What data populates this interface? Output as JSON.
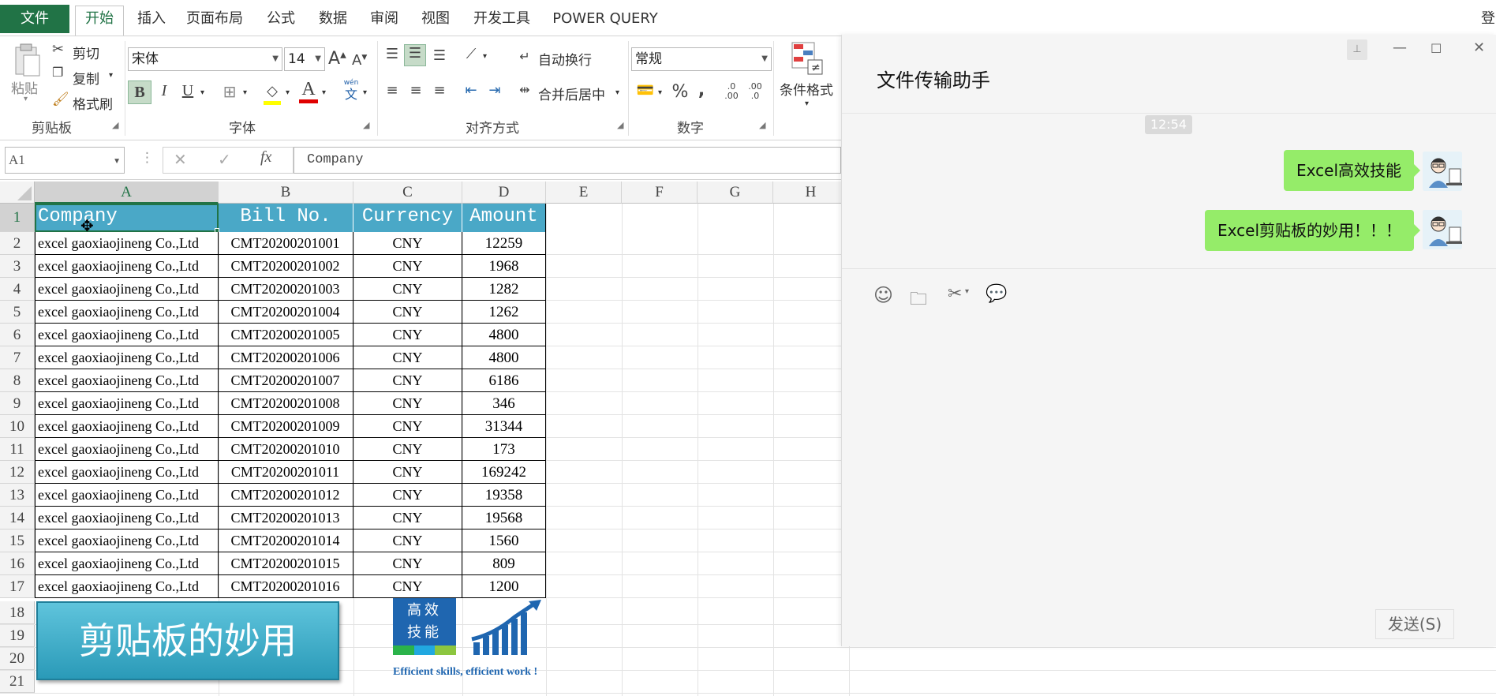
{
  "ribbon": {
    "tabs": [
      "文件",
      "开始",
      "插入",
      "页面布局",
      "公式",
      "数据",
      "审阅",
      "视图",
      "开发工具",
      "POWER QUERY"
    ],
    "user_partial": "登",
    "clipboard": {
      "paste": "粘贴",
      "cut": "剪切",
      "copy": "复制",
      "format_painter": "格式刷",
      "group": "剪贴板"
    },
    "font": {
      "name": "宋体",
      "size": "14",
      "bold": "B",
      "italic": "I",
      "underline": "U",
      "phonetic_top": "wén",
      "phonetic_bottom": "文",
      "group": "字体"
    },
    "alignment": {
      "wrap": "自动换行",
      "merge": "合并后居中",
      "group": "对齐方式"
    },
    "number": {
      "format": "常规",
      "percent": "%",
      "comma": ",",
      "inc_dec": ".0\n.00",
      "dec_dec": ".00\n.0",
      "group": "数字"
    },
    "styles": {
      "conditional": "条件格式"
    }
  },
  "formula_bar": {
    "name_box": "A1",
    "fx": "fx",
    "value": "Company"
  },
  "sheet": {
    "columns": [
      "A",
      "B",
      "C",
      "D",
      "E",
      "F",
      "G",
      "H"
    ],
    "headers": [
      "Company",
      "Bill No.",
      "Currency",
      "Amount"
    ],
    "rows": [
      {
        "n": "2",
        "company": "excel gaoxiaojineng Co.,Ltd",
        "bill": "CMT20200201001",
        "cur": "CNY",
        "amt": "12259"
      },
      {
        "n": "3",
        "company": "excel gaoxiaojineng Co.,Ltd",
        "bill": "CMT20200201002",
        "cur": "CNY",
        "amt": "1968"
      },
      {
        "n": "4",
        "company": "excel gaoxiaojineng Co.,Ltd",
        "bill": "CMT20200201003",
        "cur": "CNY",
        "amt": "1282"
      },
      {
        "n": "5",
        "company": "excel gaoxiaojineng Co.,Ltd",
        "bill": "CMT20200201004",
        "cur": "CNY",
        "amt": "1262"
      },
      {
        "n": "6",
        "company": "excel gaoxiaojineng Co.,Ltd",
        "bill": "CMT20200201005",
        "cur": "CNY",
        "amt": "4800"
      },
      {
        "n": "7",
        "company": "excel gaoxiaojineng Co.,Ltd",
        "bill": "CMT20200201006",
        "cur": "CNY",
        "amt": "4800"
      },
      {
        "n": "8",
        "company": "excel gaoxiaojineng Co.,Ltd",
        "bill": "CMT20200201007",
        "cur": "CNY",
        "amt": "6186"
      },
      {
        "n": "9",
        "company": "excel gaoxiaojineng Co.,Ltd",
        "bill": "CMT20200201008",
        "cur": "CNY",
        "amt": "346"
      },
      {
        "n": "10",
        "company": "excel gaoxiaojineng Co.,Ltd",
        "bill": "CMT20200201009",
        "cur": "CNY",
        "amt": "31344"
      },
      {
        "n": "11",
        "company": "excel gaoxiaojineng Co.,Ltd",
        "bill": "CMT20200201010",
        "cur": "CNY",
        "amt": "173"
      },
      {
        "n": "12",
        "company": "excel gaoxiaojineng Co.,Ltd",
        "bill": "CMT20200201011",
        "cur": "CNY",
        "amt": "169242"
      },
      {
        "n": "13",
        "company": "excel gaoxiaojineng Co.,Ltd",
        "bill": "CMT20200201012",
        "cur": "CNY",
        "amt": "19358"
      },
      {
        "n": "14",
        "company": "excel gaoxiaojineng Co.,Ltd",
        "bill": "CMT20200201013",
        "cur": "CNY",
        "amt": "19568"
      },
      {
        "n": "15",
        "company": "excel gaoxiaojineng Co.,Ltd",
        "bill": "CMT20200201014",
        "cur": "CNY",
        "amt": "1560"
      },
      {
        "n": "16",
        "company": "excel gaoxiaojineng Co.,Ltd",
        "bill": "CMT20200201015",
        "cur": "CNY",
        "amt": "809"
      },
      {
        "n": "17",
        "company": "excel gaoxiaojineng Co.,Ltd",
        "bill": "CMT20200201016",
        "cur": "CNY",
        "amt": "1200"
      }
    ],
    "extra_rows": [
      "1",
      "18",
      "19",
      "20",
      "21"
    ],
    "banner": "剪贴板的妙用",
    "logo": {
      "line1": "高效",
      "line2": "技能",
      "slogan": "Efficient skills, efficient work !"
    }
  },
  "chat": {
    "title": "文件传输助手",
    "time": "12:54",
    "messages": [
      "Excel高效技能",
      "Excel剪贴板的妙用！！！"
    ],
    "send": "发送(S)"
  },
  "colors": {
    "excel_green": "#217346",
    "header_fill": "#4aa8c7",
    "bubble": "#95ec69"
  }
}
